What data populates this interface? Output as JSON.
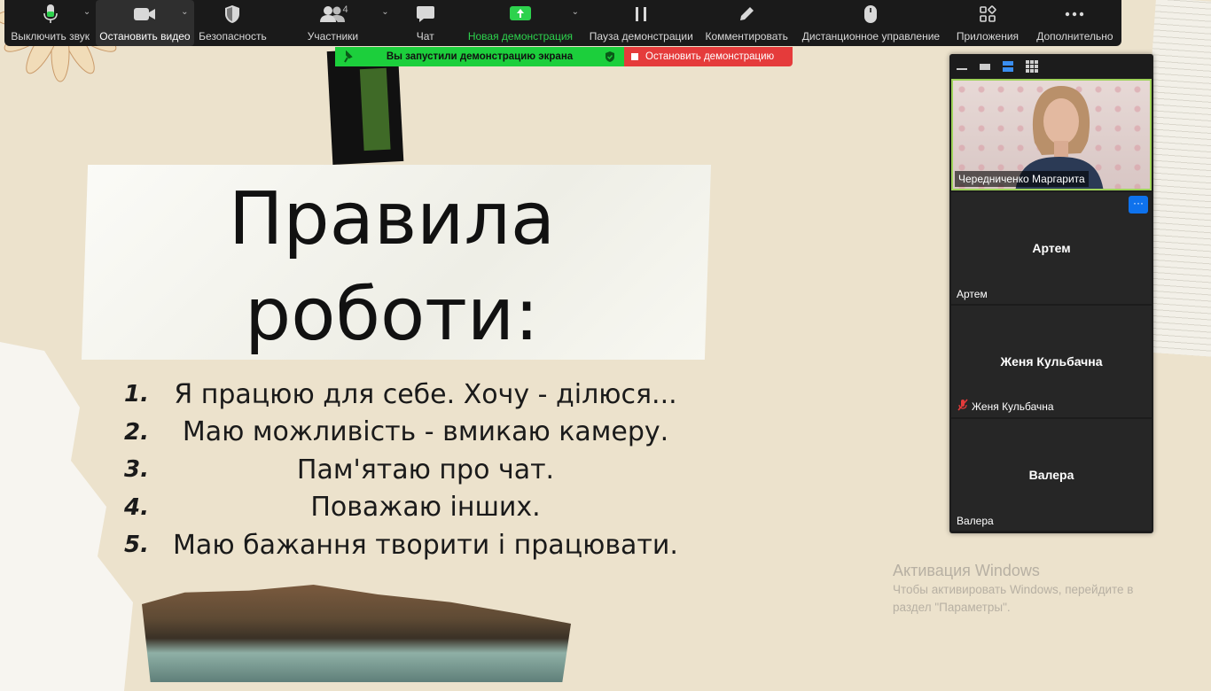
{
  "toolbar": {
    "mute_label": "Выключить звук",
    "stop_video_label": "Остановить видео",
    "security_label": "Безопасность",
    "participants_label": "Участники",
    "participants_count": "4",
    "chat_label": "Чат",
    "new_share_label": "Новая демонстрация",
    "pause_share_label": "Пауза демонстрации",
    "annotate_label": "Комментировать",
    "remote_control_label": "Дистанционное управление",
    "apps_label": "Приложения",
    "more_label": "Дополнительно"
  },
  "share_banner": {
    "status_text": "Вы запустили демонстрацию экрана",
    "stop_label": "Остановить демонстрацию"
  },
  "slide": {
    "title_line1": "Правила",
    "title_line2": "роботи:",
    "rules": [
      {
        "num": "1.",
        "text": "Я працюю для себе. Хочу - ділюся..."
      },
      {
        "num": "2.",
        "text": "Маю можливість - вмикаю камеру."
      },
      {
        "num": "3.",
        "text": "Пам'ятаю про чат."
      },
      {
        "num": "4.",
        "text": "Поважаю інших."
      },
      {
        "num": "5.",
        "text": "Маю бажання творити і працювати."
      }
    ]
  },
  "participants": {
    "self_name": "Чередниченко Маргарита",
    "tiles": [
      {
        "display": "Артем",
        "name": "Артем",
        "muted": false
      },
      {
        "display": "Женя Кульбачна",
        "name": "Женя Кульбачна",
        "muted": true
      },
      {
        "display": "Валера",
        "name": "Валера",
        "muted": false
      }
    ],
    "more_label": "···"
  },
  "watermark": {
    "title": "Активация Windows",
    "line1": "Чтобы активировать Windows, перейдите в",
    "line2": "раздел \"Параметры\"."
  },
  "colors": {
    "toolbar_bg": "#1a1a1a",
    "share_green": "#1ccf3c",
    "stop_red": "#e53b3b",
    "accent_blue": "#0e72ed",
    "slide_bg": "#ece2cc"
  }
}
